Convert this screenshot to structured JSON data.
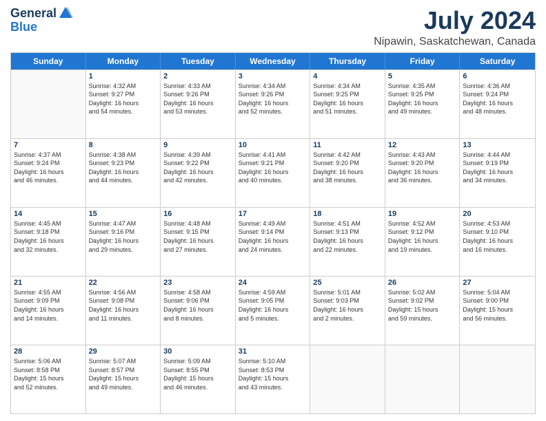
{
  "header": {
    "logo_general": "General",
    "logo_blue": "Blue",
    "month": "July 2024",
    "location": "Nipawin, Saskatchewan, Canada"
  },
  "days_of_week": [
    "Sunday",
    "Monday",
    "Tuesday",
    "Wednesday",
    "Thursday",
    "Friday",
    "Saturday"
  ],
  "weeks": [
    [
      {
        "day": "",
        "info": ""
      },
      {
        "day": "1",
        "info": "Sunrise: 4:32 AM\nSunset: 9:27 PM\nDaylight: 16 hours\nand 54 minutes."
      },
      {
        "day": "2",
        "info": "Sunrise: 4:33 AM\nSunset: 9:26 PM\nDaylight: 16 hours\nand 53 minutes."
      },
      {
        "day": "3",
        "info": "Sunrise: 4:34 AM\nSunset: 9:26 PM\nDaylight: 16 hours\nand 52 minutes."
      },
      {
        "day": "4",
        "info": "Sunrise: 4:34 AM\nSunset: 9:25 PM\nDaylight: 16 hours\nand 51 minutes."
      },
      {
        "day": "5",
        "info": "Sunrise: 4:35 AM\nSunset: 9:25 PM\nDaylight: 16 hours\nand 49 minutes."
      },
      {
        "day": "6",
        "info": "Sunrise: 4:36 AM\nSunset: 9:24 PM\nDaylight: 16 hours\nand 48 minutes."
      }
    ],
    [
      {
        "day": "7",
        "info": "Sunrise: 4:37 AM\nSunset: 9:24 PM\nDaylight: 16 hours\nand 46 minutes."
      },
      {
        "day": "8",
        "info": "Sunrise: 4:38 AM\nSunset: 9:23 PM\nDaylight: 16 hours\nand 44 minutes."
      },
      {
        "day": "9",
        "info": "Sunrise: 4:39 AM\nSunset: 9:22 PM\nDaylight: 16 hours\nand 42 minutes."
      },
      {
        "day": "10",
        "info": "Sunrise: 4:41 AM\nSunset: 9:21 PM\nDaylight: 16 hours\nand 40 minutes."
      },
      {
        "day": "11",
        "info": "Sunrise: 4:42 AM\nSunset: 9:20 PM\nDaylight: 16 hours\nand 38 minutes."
      },
      {
        "day": "12",
        "info": "Sunrise: 4:43 AM\nSunset: 9:20 PM\nDaylight: 16 hours\nand 36 minutes."
      },
      {
        "day": "13",
        "info": "Sunrise: 4:44 AM\nSunset: 9:19 PM\nDaylight: 16 hours\nand 34 minutes."
      }
    ],
    [
      {
        "day": "14",
        "info": "Sunrise: 4:45 AM\nSunset: 9:18 PM\nDaylight: 16 hours\nand 32 minutes."
      },
      {
        "day": "15",
        "info": "Sunrise: 4:47 AM\nSunset: 9:16 PM\nDaylight: 16 hours\nand 29 minutes."
      },
      {
        "day": "16",
        "info": "Sunrise: 4:48 AM\nSunset: 9:15 PM\nDaylight: 16 hours\nand 27 minutes."
      },
      {
        "day": "17",
        "info": "Sunrise: 4:49 AM\nSunset: 9:14 PM\nDaylight: 16 hours\nand 24 minutes."
      },
      {
        "day": "18",
        "info": "Sunrise: 4:51 AM\nSunset: 9:13 PM\nDaylight: 16 hours\nand 22 minutes."
      },
      {
        "day": "19",
        "info": "Sunrise: 4:52 AM\nSunset: 9:12 PM\nDaylight: 16 hours\nand 19 minutes."
      },
      {
        "day": "20",
        "info": "Sunrise: 4:53 AM\nSunset: 9:10 PM\nDaylight: 16 hours\nand 16 minutes."
      }
    ],
    [
      {
        "day": "21",
        "info": "Sunrise: 4:55 AM\nSunset: 9:09 PM\nDaylight: 16 hours\nand 14 minutes."
      },
      {
        "day": "22",
        "info": "Sunrise: 4:56 AM\nSunset: 9:08 PM\nDaylight: 16 hours\nand 11 minutes."
      },
      {
        "day": "23",
        "info": "Sunrise: 4:58 AM\nSunset: 9:06 PM\nDaylight: 16 hours\nand 8 minutes."
      },
      {
        "day": "24",
        "info": "Sunrise: 4:59 AM\nSunset: 9:05 PM\nDaylight: 16 hours\nand 5 minutes."
      },
      {
        "day": "25",
        "info": "Sunrise: 5:01 AM\nSunset: 9:03 PM\nDaylight: 16 hours\nand 2 minutes."
      },
      {
        "day": "26",
        "info": "Sunrise: 5:02 AM\nSunset: 9:02 PM\nDaylight: 15 hours\nand 59 minutes."
      },
      {
        "day": "27",
        "info": "Sunrise: 5:04 AM\nSunset: 9:00 PM\nDaylight: 15 hours\nand 56 minutes."
      }
    ],
    [
      {
        "day": "28",
        "info": "Sunrise: 5:06 AM\nSunset: 8:58 PM\nDaylight: 15 hours\nand 52 minutes."
      },
      {
        "day": "29",
        "info": "Sunrise: 5:07 AM\nSunset: 8:57 PM\nDaylight: 15 hours\nand 49 minutes."
      },
      {
        "day": "30",
        "info": "Sunrise: 5:09 AM\nSunset: 8:55 PM\nDaylight: 15 hours\nand 46 minutes."
      },
      {
        "day": "31",
        "info": "Sunrise: 5:10 AM\nSunset: 8:53 PM\nDaylight: 15 hours\nand 43 minutes."
      },
      {
        "day": "",
        "info": ""
      },
      {
        "day": "",
        "info": ""
      },
      {
        "day": "",
        "info": ""
      }
    ]
  ]
}
